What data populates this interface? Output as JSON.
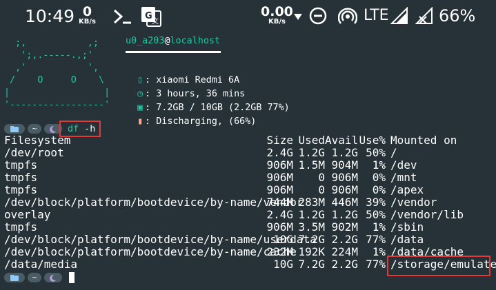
{
  "statusbar": {
    "time": "10:49",
    "net_rate_left": {
      "value": "0",
      "unit": "KB/s"
    },
    "net_rate_right": {
      "value": "0.00",
      "unit": "KB/s"
    },
    "network_type": "LTE",
    "battery": "66%",
    "icons": [
      "terminal-icon",
      "translate-icon",
      "dnd-icon",
      "hotspot-icon",
      "signal-icon",
      "signal-off-icon"
    ]
  },
  "neofetch": {
    "ascii": "  ;,           ,;\n   ';,.-----.,;'\n  ,'           ',\n /    O     O    \\\n|                 |\n'-----------------'",
    "user": "u0_a203",
    "at": "@",
    "host": "localhost",
    "rows": [
      {
        "icon": "phone-icon",
        "glyph": "▯",
        "text": ": xiaomi Redmi 6A"
      },
      {
        "icon": "clock-icon",
        "glyph": "◷",
        "text": ": 3 hours, 36 mins"
      },
      {
        "icon": "memory-icon",
        "glyph": "▣",
        "text": ": 7.2GB / 10GB (2.2GB 77%)"
      },
      {
        "icon": "battery-icon",
        "glyph": "▮",
        "text": ": Discharging, (66%)"
      }
    ]
  },
  "prompt": {
    "tilde": "~",
    "command": "df",
    "flag": "-h"
  },
  "df": {
    "headers": [
      "Filesystem",
      "Size",
      "Used",
      "Avail",
      "Use%",
      "Mounted on"
    ],
    "rows": [
      [
        "/dev/root",
        "2.4G",
        "1.2G",
        "1.2G",
        "50%",
        "/"
      ],
      [
        "tmpfs",
        "906M",
        "1.5M",
        "904M",
        "1%",
        "/dev"
      ],
      [
        "tmpfs",
        "906M",
        "0",
        "906M",
        "0%",
        "/mnt"
      ],
      [
        "tmpfs",
        "906M",
        "0",
        "906M",
        "0%",
        "/apex"
      ],
      [
        "/dev/block/platform/bootdevice/by-name/vendor",
        "744M",
        "283M",
        "446M",
        "39%",
        "/vendor"
      ],
      [
        "overlay",
        "2.4G",
        "1.2G",
        "1.2G",
        "50%",
        "/vendor/lib"
      ],
      [
        "tmpfs",
        "906M",
        "3.5M",
        "902M",
        "1%",
        "/sbin"
      ],
      [
        "/dev/block/platform/bootdevice/by-name/userdata",
        "10G",
        "7.2G",
        "2.2G",
        "77%",
        "/data"
      ],
      [
        "/dev/block/platform/bootdevice/by-name/cache",
        "232M",
        "192K",
        "224M",
        "1%",
        "/data/cache"
      ],
      [
        "/data/media",
        "10G",
        "7.2G",
        "2.2G",
        "77%",
        "/storage/emulated"
      ]
    ]
  },
  "colors": {
    "background": "#263238",
    "accent": "#26c6a5",
    "highlight": "#e53935",
    "battery": "#ffab91"
  }
}
